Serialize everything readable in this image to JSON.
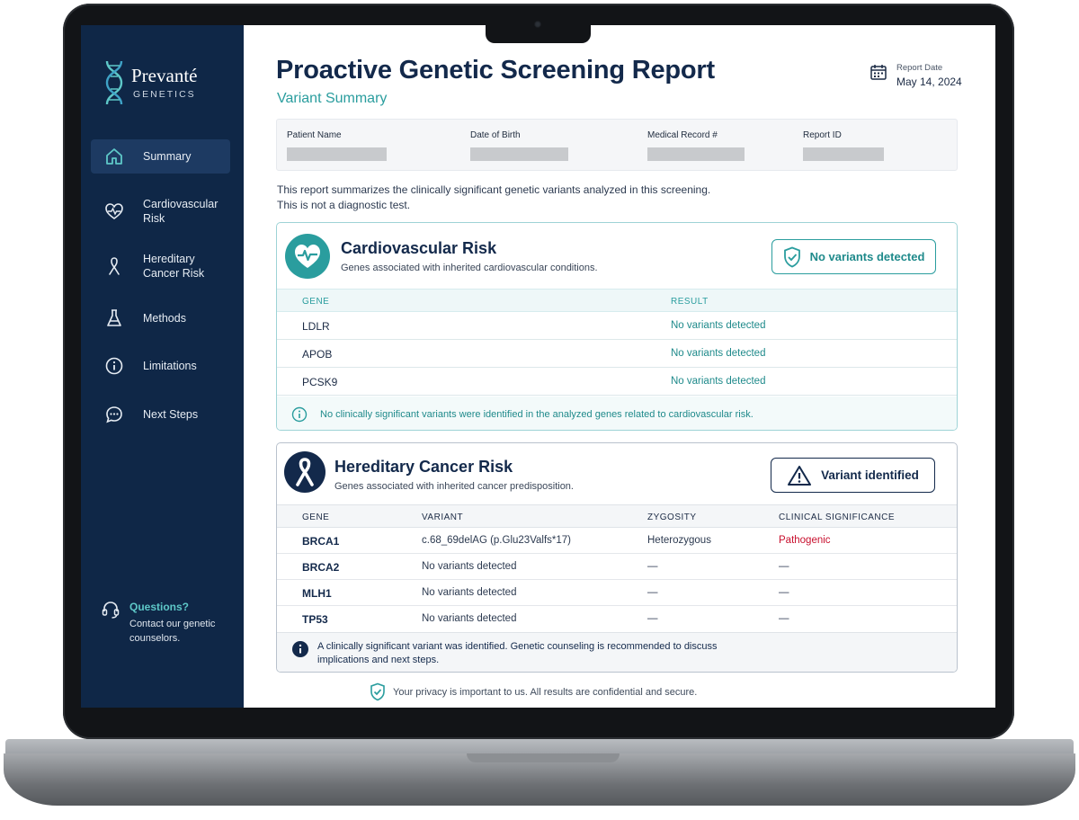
{
  "app": {
    "logo_name": "Prevanté",
    "logo_sub": "GENETICS"
  },
  "sidebar": {
    "items": [
      {
        "label": "Summary",
        "icon": "home-icon",
        "active": true
      },
      {
        "label": "Cardiovascular\nRisk",
        "icon": "heart-pulse-icon",
        "active": false
      },
      {
        "label": "Hereditary\nCancer Risk",
        "icon": "ribbon-icon",
        "active": false
      },
      {
        "label": "Methods",
        "icon": "flask-icon",
        "active": false
      },
      {
        "label": "Limitations",
        "icon": "info-icon",
        "active": false
      },
      {
        "label": "Next Steps",
        "icon": "chat-icon",
        "active": false
      }
    ],
    "help": {
      "title": "Questions?",
      "text": "Contact our genetic counselors.",
      "icon": "headset-icon"
    }
  },
  "header": {
    "title": "Proactive Genetic Screening Report",
    "subtitle": "Variant Summary",
    "report_date_label": "Report Date",
    "report_date_value": "May 14, 2024"
  },
  "patient": {
    "fields": [
      {
        "label": "Patient Name"
      },
      {
        "label": "Date of Birth"
      },
      {
        "label": "Medical Record #"
      },
      {
        "label": "Report ID"
      }
    ]
  },
  "intro": {
    "line1": "This report summarizes the clinically significant genetic variants analyzed in this screening.",
    "line2": "This is not a diagnostic test."
  },
  "cardio": {
    "title": "Cardiovascular Risk",
    "subtitle": "Genes associated with inherited cardiovascular conditions.",
    "status": "No variants detected",
    "columns": [
      "GENE",
      "RESULT"
    ],
    "rows": [
      {
        "gene": "LDLR",
        "result": "No variants detected"
      },
      {
        "gene": "APOB",
        "result": "No variants detected"
      },
      {
        "gene": "PCSK9",
        "result": "No variants detected"
      }
    ],
    "note": "No clinically significant variants were identified in the analyzed genes related to cardiovascular risk."
  },
  "cancer": {
    "title": "Hereditary Cancer Risk",
    "subtitle": "Genes associated with inherited cancer predisposition.",
    "status": "Variant identified",
    "columns": [
      "GENE",
      "VARIANT",
      "ZYGOSITY",
      "CLINICAL SIGNIFICANCE"
    ],
    "rows": [
      {
        "gene": "BRCA1",
        "variant": "c.68_69delAG (p.Glu23Valfs*17)",
        "zygosity": "Heterozygous",
        "significance": "Pathogenic"
      },
      {
        "gene": "BRCA2",
        "variant": "No variants detected",
        "zygosity": "—",
        "significance": "—"
      },
      {
        "gene": "MLH1",
        "variant": "No variants detected",
        "zygosity": "—",
        "significance": "—"
      },
      {
        "gene": "TP53",
        "variant": "No variants detected",
        "zygosity": "—",
        "significance": "—"
      }
    ],
    "note": "A clinically significant variant was identified. Genetic counseling is recommended to discuss implications and next steps."
  },
  "footer": {
    "privacy": "Your privacy is important to us. All results are confidential and secure."
  },
  "colors": {
    "navy": "#13294b",
    "sidebar": "#0f2747",
    "teal": "#2a9d9e",
    "pathogenic": "#c8102e"
  }
}
